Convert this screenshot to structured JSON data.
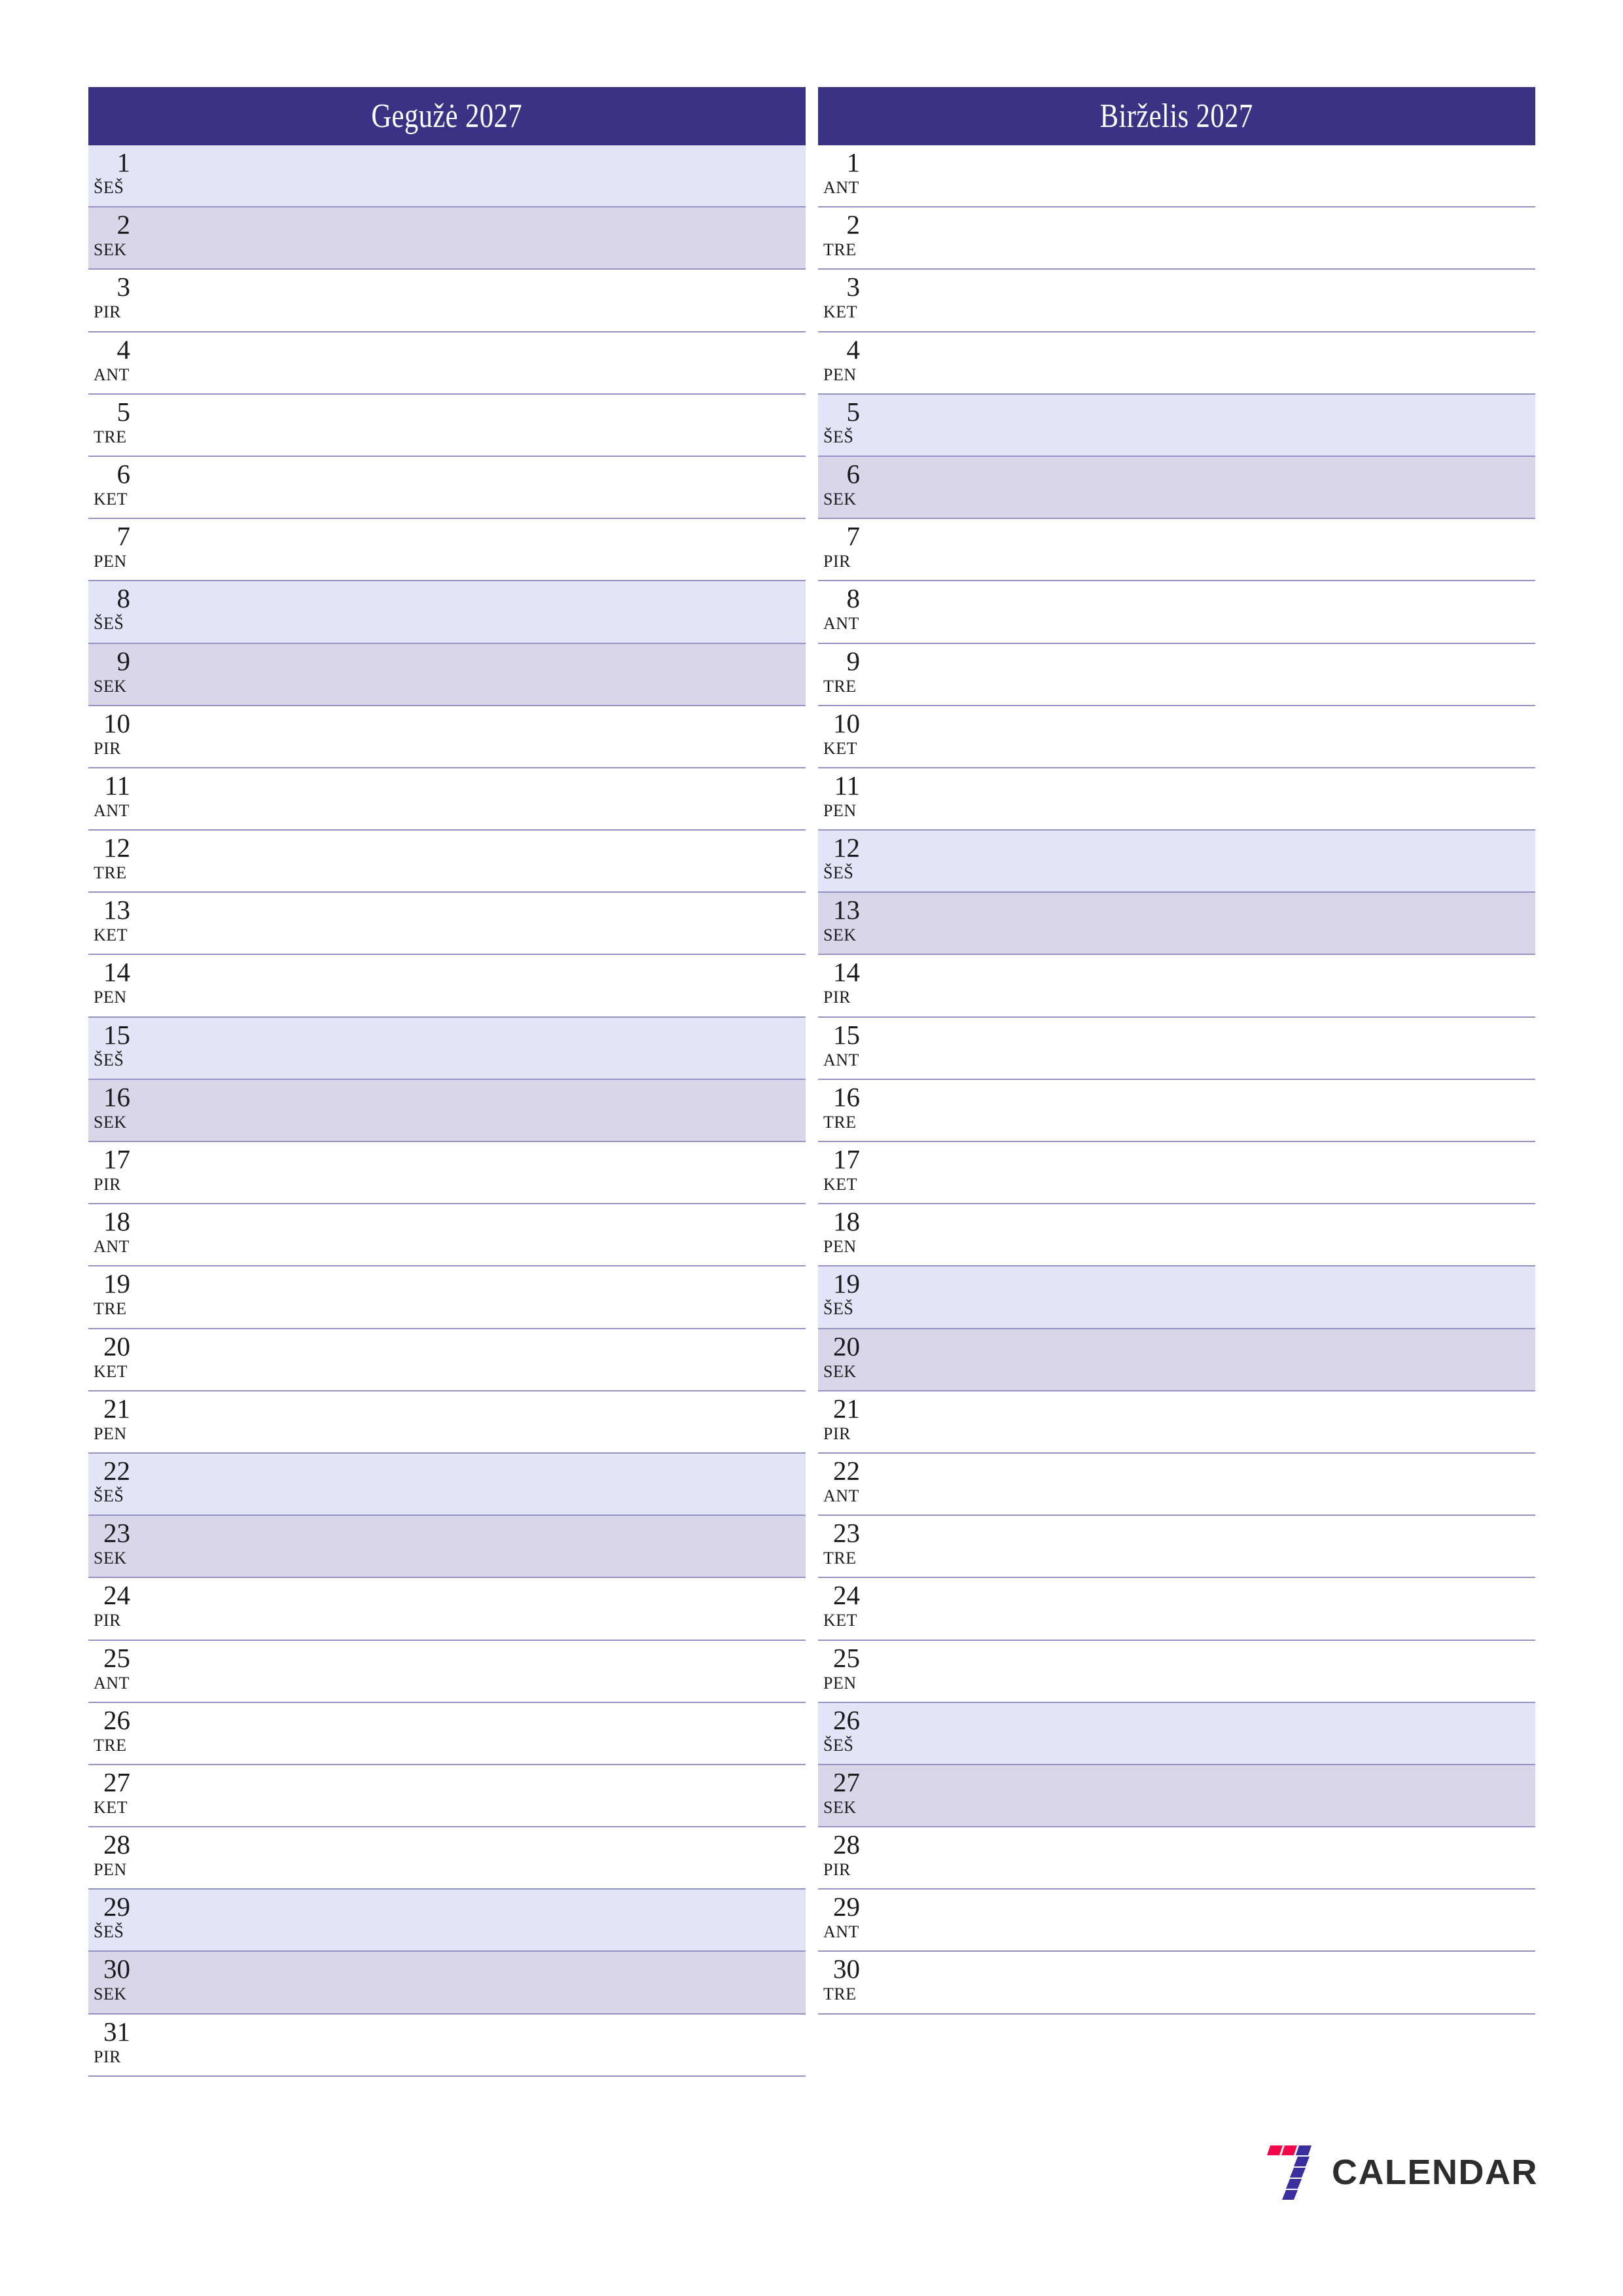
{
  "page": {
    "type": "two-month-planner",
    "orientation": "portrait"
  },
  "colors": {
    "header_bg": "#3b3285",
    "header_text": "#ffffff",
    "saturday_bg": "#e3e4f7",
    "sunday_bg": "#d9d6e9",
    "row_border": "#9492c4",
    "day_text": "#1a1a1a",
    "logo_red": "#f5064a",
    "logo_blue": "#3b2fa0",
    "logo_text": "#2d2d2d"
  },
  "months": [
    {
      "id": "month-left",
      "title": "Gegužė 2027",
      "name": "Gegužė",
      "year": "2027",
      "days": [
        {
          "num": "1",
          "weekday": "ŠEŠ",
          "kind": "sat"
        },
        {
          "num": "2",
          "weekday": "SEK",
          "kind": "sun"
        },
        {
          "num": "3",
          "weekday": "PIR",
          "kind": "weekday"
        },
        {
          "num": "4",
          "weekday": "ANT",
          "kind": "weekday"
        },
        {
          "num": "5",
          "weekday": "TRE",
          "kind": "weekday"
        },
        {
          "num": "6",
          "weekday": "KET",
          "kind": "weekday"
        },
        {
          "num": "7",
          "weekday": "PEN",
          "kind": "weekday"
        },
        {
          "num": "8",
          "weekday": "ŠEŠ",
          "kind": "sat"
        },
        {
          "num": "9",
          "weekday": "SEK",
          "kind": "sun"
        },
        {
          "num": "10",
          "weekday": "PIR",
          "kind": "weekday"
        },
        {
          "num": "11",
          "weekday": "ANT",
          "kind": "weekday"
        },
        {
          "num": "12",
          "weekday": "TRE",
          "kind": "weekday"
        },
        {
          "num": "13",
          "weekday": "KET",
          "kind": "weekday"
        },
        {
          "num": "14",
          "weekday": "PEN",
          "kind": "weekday"
        },
        {
          "num": "15",
          "weekday": "ŠEŠ",
          "kind": "sat"
        },
        {
          "num": "16",
          "weekday": "SEK",
          "kind": "sun"
        },
        {
          "num": "17",
          "weekday": "PIR",
          "kind": "weekday"
        },
        {
          "num": "18",
          "weekday": "ANT",
          "kind": "weekday"
        },
        {
          "num": "19",
          "weekday": "TRE",
          "kind": "weekday"
        },
        {
          "num": "20",
          "weekday": "KET",
          "kind": "weekday"
        },
        {
          "num": "21",
          "weekday": "PEN",
          "kind": "weekday"
        },
        {
          "num": "22",
          "weekday": "ŠEŠ",
          "kind": "sat"
        },
        {
          "num": "23",
          "weekday": "SEK",
          "kind": "sun"
        },
        {
          "num": "24",
          "weekday": "PIR",
          "kind": "weekday"
        },
        {
          "num": "25",
          "weekday": "ANT",
          "kind": "weekday"
        },
        {
          "num": "26",
          "weekday": "TRE",
          "kind": "weekday"
        },
        {
          "num": "27",
          "weekday": "KET",
          "kind": "weekday"
        },
        {
          "num": "28",
          "weekday": "PEN",
          "kind": "weekday"
        },
        {
          "num": "29",
          "weekday": "ŠEŠ",
          "kind": "sat"
        },
        {
          "num": "30",
          "weekday": "SEK",
          "kind": "sun"
        },
        {
          "num": "31",
          "weekday": "PIR",
          "kind": "weekday"
        }
      ]
    },
    {
      "id": "month-right",
      "title": "Birželis 2027",
      "name": "Birželis",
      "year": "2027",
      "days": [
        {
          "num": "1",
          "weekday": "ANT",
          "kind": "weekday"
        },
        {
          "num": "2",
          "weekday": "TRE",
          "kind": "weekday"
        },
        {
          "num": "3",
          "weekday": "KET",
          "kind": "weekday"
        },
        {
          "num": "4",
          "weekday": "PEN",
          "kind": "weekday"
        },
        {
          "num": "5",
          "weekday": "ŠEŠ",
          "kind": "sat"
        },
        {
          "num": "6",
          "weekday": "SEK",
          "kind": "sun"
        },
        {
          "num": "7",
          "weekday": "PIR",
          "kind": "weekday"
        },
        {
          "num": "8",
          "weekday": "ANT",
          "kind": "weekday"
        },
        {
          "num": "9",
          "weekday": "TRE",
          "kind": "weekday"
        },
        {
          "num": "10",
          "weekday": "KET",
          "kind": "weekday"
        },
        {
          "num": "11",
          "weekday": "PEN",
          "kind": "weekday"
        },
        {
          "num": "12",
          "weekday": "ŠEŠ",
          "kind": "sat"
        },
        {
          "num": "13",
          "weekday": "SEK",
          "kind": "sun"
        },
        {
          "num": "14",
          "weekday": "PIR",
          "kind": "weekday"
        },
        {
          "num": "15",
          "weekday": "ANT",
          "kind": "weekday"
        },
        {
          "num": "16",
          "weekday": "TRE",
          "kind": "weekday"
        },
        {
          "num": "17",
          "weekday": "KET",
          "kind": "weekday"
        },
        {
          "num": "18",
          "weekday": "PEN",
          "kind": "weekday"
        },
        {
          "num": "19",
          "weekday": "ŠEŠ",
          "kind": "sat"
        },
        {
          "num": "20",
          "weekday": "SEK",
          "kind": "sun"
        },
        {
          "num": "21",
          "weekday": "PIR",
          "kind": "weekday"
        },
        {
          "num": "22",
          "weekday": "ANT",
          "kind": "weekday"
        },
        {
          "num": "23",
          "weekday": "TRE",
          "kind": "weekday"
        },
        {
          "num": "24",
          "weekday": "KET",
          "kind": "weekday"
        },
        {
          "num": "25",
          "weekday": "PEN",
          "kind": "weekday"
        },
        {
          "num": "26",
          "weekday": "ŠEŠ",
          "kind": "sat"
        },
        {
          "num": "27",
          "weekday": "SEK",
          "kind": "sun"
        },
        {
          "num": "28",
          "weekday": "PIR",
          "kind": "weekday"
        },
        {
          "num": "29",
          "weekday": "ANT",
          "kind": "weekday"
        },
        {
          "num": "30",
          "weekday": "TRE",
          "kind": "weekday"
        }
      ]
    }
  ],
  "footer": {
    "logo_text": "CALENDAR",
    "logo_mark": "seven-blocks-logo-icon"
  }
}
